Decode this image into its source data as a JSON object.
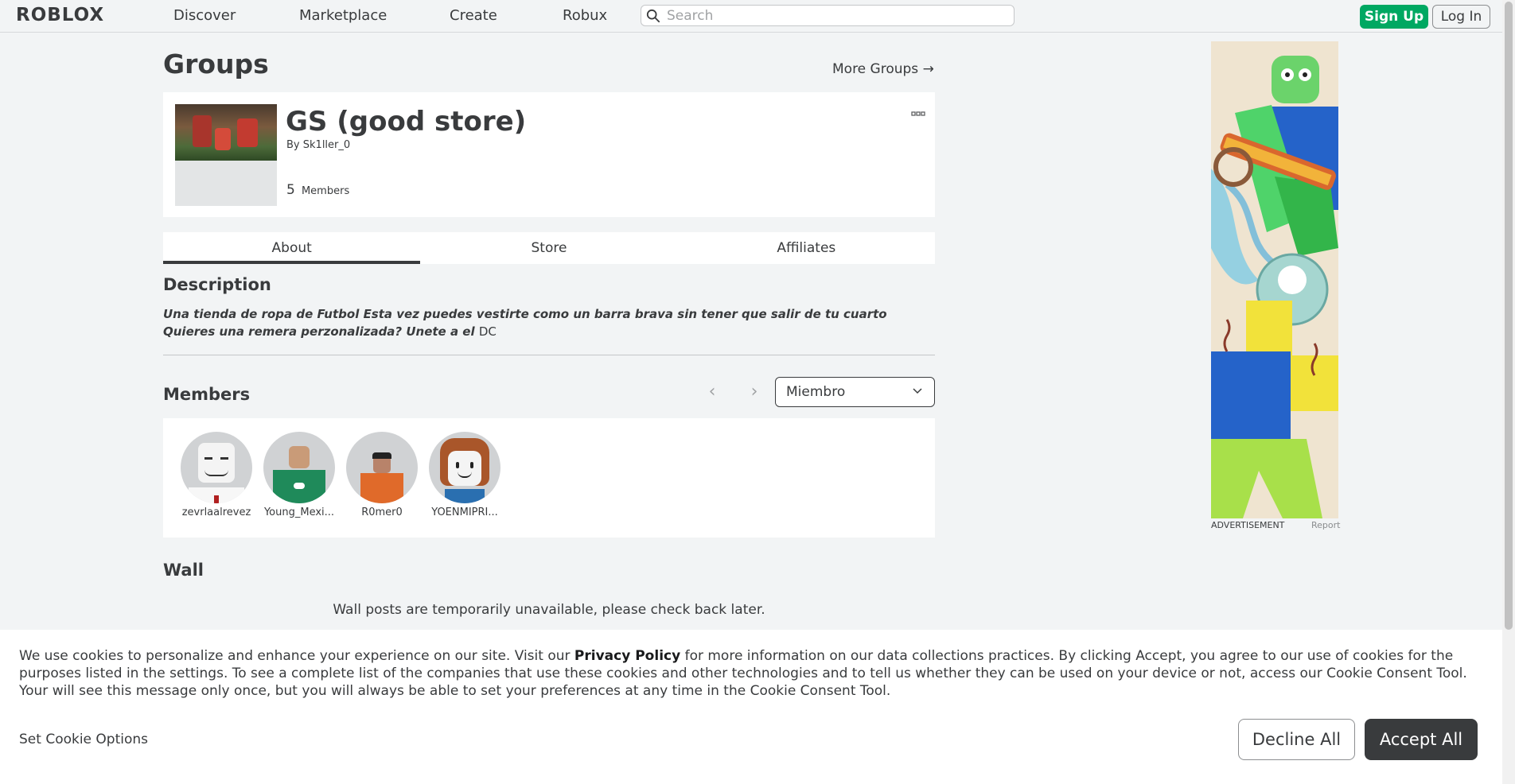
{
  "nav": {
    "logo": "ROBLOX",
    "links": [
      "Discover",
      "Marketplace",
      "Create",
      "Robux"
    ],
    "search_placeholder": "Search",
    "signup_label": "Sign Up",
    "login_label": "Log In"
  },
  "header": {
    "title": "Groups",
    "more_groups": "More Groups →"
  },
  "group": {
    "name": "GS (good store)",
    "by_label": "By",
    "owner": "Sk1ller_0",
    "member_count": "5",
    "members_label": "Members",
    "menu_icon": "more-dots-icon"
  },
  "tabs": [
    "About",
    "Store",
    "Affiliates"
  ],
  "description": {
    "heading": "Description",
    "text": "Una tienda de ropa de Futbol Esta vez puedes vestirte como un barra brava sin tener que salir de tu cuarto Quieres una remera perzonalizada? Unete a el",
    "suffix": "DC"
  },
  "members_section": {
    "heading": "Members",
    "role_filter": "Miembro",
    "members": [
      {
        "name": "zevrlaalrevez"
      },
      {
        "name": "Young_Mexi..."
      },
      {
        "name": "R0mer0"
      },
      {
        "name": "YOENMIPRI..."
      }
    ]
  },
  "wall": {
    "heading": "Wall",
    "message": "Wall posts are temporarily unavailable, please check back later."
  },
  "ad": {
    "label": "ADVERTISEMENT",
    "report": "Report"
  },
  "cookie": {
    "text_before": "We use cookies to personalize and enhance your experience on our site. Visit our",
    "privacy_link": "Privacy Policy",
    "text_after": "for more information on our data collections practices. By clicking Accept, you agree to our use of cookies for the purposes listed in the settings. To see a complete list of the companies that use these cookies and other technologies and to tell us whether they can be used on your device or not, access our Cookie Consent Tool. Your will see this message only once, but you will always be able to set your preferences at any time in the Cookie Consent Tool.",
    "set_options": "Set Cookie Options",
    "decline": "Decline All",
    "accept": "Accept All"
  },
  "colors": {
    "signup_green": "#00a862",
    "background": "#f2f4f5",
    "text": "#393b3d"
  }
}
